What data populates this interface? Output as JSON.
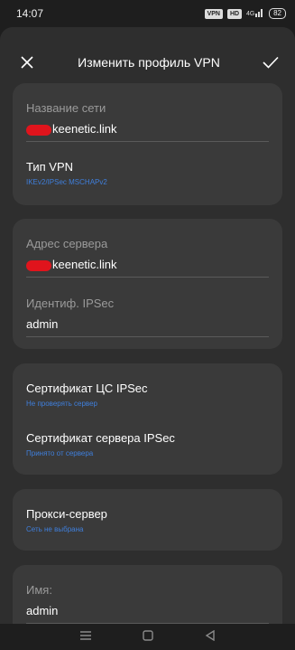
{
  "status": {
    "time": "14:07",
    "vpn_tag": "VPN",
    "hd_tag": "HD",
    "signal": "4G",
    "battery": "82"
  },
  "header": {
    "title": "Изменить профиль VPN",
    "close_icon": "close-icon",
    "confirm_icon": "check-icon"
  },
  "card1": {
    "name_label": "Название сети",
    "name_value": "keenetic.link",
    "vpn_type_label": "Тип VPN",
    "vpn_type_value": "IKEv2/IPSec MSCHAPv2"
  },
  "card2": {
    "server_label": "Адрес сервера",
    "server_value": "keenetic.link",
    "ipsec_id_label": "Идентиф. IPSec",
    "ipsec_id_value": "admin"
  },
  "card3": {
    "ca_cert_label": "Сертификат ЦС IPSec",
    "ca_cert_value": "Не проверять сервер",
    "server_cert_label": "Сертификат сервера IPSec",
    "server_cert_value": "Принято от сервера"
  },
  "card4": {
    "proxy_label": "Прокси-сервер",
    "proxy_value": "Сеть не выбрана"
  },
  "card5": {
    "username_label": "Имя:",
    "username_value": "admin"
  },
  "colors": {
    "accent_blue": "#3f7fdc",
    "card_bg": "#3a3a3a",
    "sheet_bg": "#2e2e2e",
    "redaction": "#e0141c"
  }
}
